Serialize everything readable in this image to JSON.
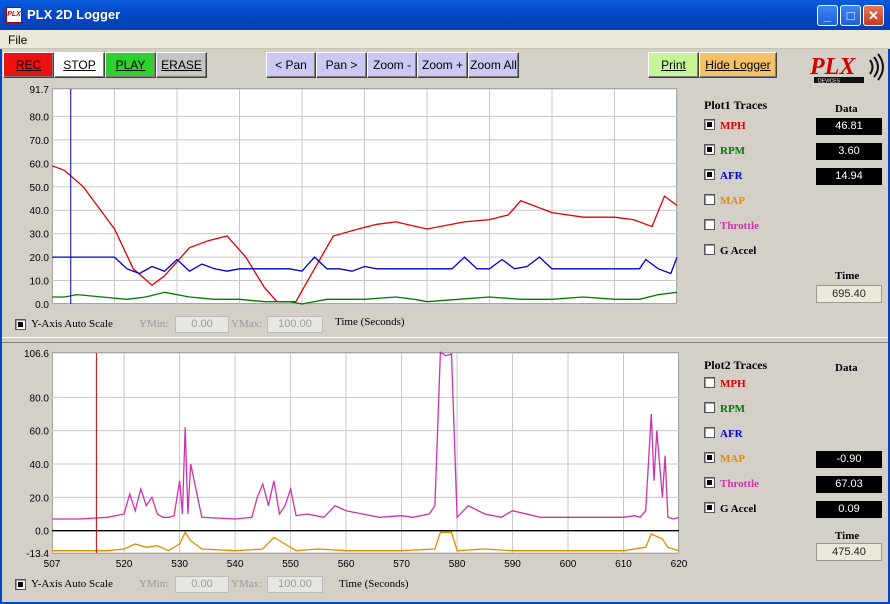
{
  "window": {
    "title": "PLX 2D Logger",
    "icon_text": "PLX",
    "minimize": "_",
    "maximize": "□",
    "close": "✕"
  },
  "menu": {
    "file": "File"
  },
  "toolbar": [
    {
      "name": "rec-button",
      "label": "REC",
      "bg": "#ee1111",
      "x": 3,
      "w": 51
    },
    {
      "name": "stop-button",
      "label": "STOP",
      "bg": "#ffffff",
      "x": 54,
      "w": 51
    },
    {
      "name": "play-button",
      "label": "PLAY",
      "bg": "#2ed12e",
      "x": 105,
      "w": 51
    },
    {
      "name": "erase-button",
      "label": "ERASE",
      "bg": "#c4c4c4",
      "x": 156,
      "w": 51
    },
    {
      "name": "pan-left-button",
      "label": "< Pan",
      "bg": "#c9c9f4",
      "x": 266,
      "w": 50,
      "nav": true
    },
    {
      "name": "pan-right-button",
      "label": "Pan >",
      "bg": "#c9c9f4",
      "x": 316,
      "w": 51,
      "nav": true
    },
    {
      "name": "zoom-out-button",
      "label": "Zoom -",
      "bg": "#c9c9f4",
      "x": 367,
      "w": 50,
      "nav": true
    },
    {
      "name": "zoom-in-button",
      "label": "Zoom +",
      "bg": "#c9c9f4",
      "x": 417,
      "w": 51,
      "nav": true
    },
    {
      "name": "zoom-all-button",
      "label": "Zoom All",
      "bg": "#c9c9f4",
      "x": 468,
      "w": 51,
      "nav": true
    },
    {
      "name": "print-button",
      "label": "Print",
      "bg": "#c8f59a",
      "x": 648,
      "w": 51
    },
    {
      "name": "hide-logger-button",
      "label": "Hide Logger",
      "bg": "#f5c066",
      "x": 699,
      "w": 78
    }
  ],
  "logo": {
    "text": "PLX",
    "subtext": "DEVICES"
  },
  "plot1": {
    "ymin_label": "YMin:",
    "ymin_value": "0.00",
    "ymax_label": "YMax:",
    "ymax_value": "100.00",
    "autoscale_label": "Y-Axis Auto Scale",
    "xlabel": "Time (Seconds)",
    "traces_title": "Plot1 Traces",
    "data_title": "Data",
    "time_title": "Time",
    "time_value": "695.40",
    "traces": [
      {
        "name": "MPH",
        "color": "#e00000",
        "checked": true,
        "value": "46.81"
      },
      {
        "name": "RPM",
        "color": "#007a00",
        "checked": true,
        "value": "3.60"
      },
      {
        "name": "AFR",
        "color": "#0000cc",
        "checked": true,
        "value": "14.94"
      },
      {
        "name": "MAP",
        "color": "#e88a00",
        "checked": false,
        "value": ""
      },
      {
        "name": "Throttle",
        "color": "#cc33aa",
        "checked": false,
        "value": ""
      },
      {
        "name": "G Accel",
        "color": "#000000",
        "checked": false,
        "value": ""
      }
    ]
  },
  "plot2": {
    "ymin_label": "YMin:",
    "ymin_value": "0.00",
    "ymax_label": "YMax:",
    "ymax_value": "100.00",
    "autoscale_label": "Y-Axis Auto Scale",
    "xlabel": "Time (Seconds)",
    "traces_title": "Plot2 Traces",
    "data_title": "Data",
    "time_title": "Time",
    "time_value": "475.40",
    "traces": [
      {
        "name": "MPH",
        "color": "#e00000",
        "checked": false,
        "value": ""
      },
      {
        "name": "RPM",
        "color": "#007a00",
        "checked": false,
        "value": ""
      },
      {
        "name": "AFR",
        "color": "#0000cc",
        "checked": false,
        "value": ""
      },
      {
        "name": "MAP",
        "color": "#e88a00",
        "checked": true,
        "value": "-0.90"
      },
      {
        "name": "Throttle",
        "color": "#cc33aa",
        "checked": true,
        "value": "67.03"
      },
      {
        "name": "G Accel",
        "color": "#000000",
        "checked": true,
        "value": "0.09"
      }
    ]
  },
  "chart_data": [
    {
      "type": "line",
      "ylim": [
        0,
        91.7
      ],
      "yticks": [
        "91.7",
        "80.0",
        "70.0",
        "60.0",
        "50.0",
        "40.0",
        "30.0",
        "20.0",
        "10.0",
        "0.0"
      ],
      "ytick_values": [
        91.7,
        80,
        70,
        60,
        50,
        40,
        30,
        20,
        10,
        0
      ],
      "xlim": [
        0,
        100
      ],
      "grid": true,
      "cursor_x": 3,
      "series": [
        {
          "name": "MPH",
          "color": "#e00000",
          "x": [
            0,
            2,
            5,
            10,
            13,
            16,
            18,
            20,
            22,
            25,
            28,
            31,
            34,
            36,
            39,
            42,
            45,
            49,
            52,
            55,
            60,
            66,
            70,
            73,
            75,
            80,
            85,
            90,
            93,
            96,
            98,
            100
          ],
          "y": [
            59,
            57,
            50,
            32,
            15,
            8,
            12,
            18,
            24,
            27,
            29,
            20,
            7,
            1,
            1,
            15,
            29,
            32,
            34,
            35,
            32,
            35,
            36,
            38,
            44,
            39,
            37,
            37,
            36,
            33,
            46,
            42
          ]
        },
        {
          "name": "RPM",
          "color": "#007a00",
          "x": [
            0,
            2,
            4,
            8,
            12,
            15,
            18,
            22,
            26,
            30,
            34,
            38,
            40,
            44,
            50,
            55,
            58,
            60,
            65,
            70,
            75,
            80,
            85,
            90,
            94,
            97,
            100
          ],
          "y": [
            3,
            3,
            4,
            3,
            2,
            3,
            5,
            3,
            2,
            2,
            1,
            1,
            0,
            2,
            2,
            3,
            2,
            1,
            2,
            3,
            2,
            2,
            3,
            2,
            2,
            4,
            5
          ]
        },
        {
          "name": "AFR",
          "color": "#0000cc",
          "x": [
            0,
            10,
            12,
            14,
            16,
            18,
            20,
            22,
            24,
            26,
            28,
            30,
            32,
            34,
            36,
            38,
            40,
            42,
            44,
            46,
            48,
            50,
            52,
            54,
            56,
            58,
            60,
            62,
            64,
            66,
            68,
            70,
            72,
            74,
            76,
            78,
            80,
            82,
            85,
            88,
            90,
            92,
            94,
            95,
            97,
            99,
            100
          ],
          "y": [
            20,
            20,
            15,
            13,
            16,
            14,
            19,
            14,
            17,
            15,
            14,
            15,
            15,
            15,
            15,
            15,
            14,
            20,
            15,
            15,
            14,
            16,
            15,
            15,
            15,
            15,
            15,
            15,
            15,
            20,
            15,
            15,
            19,
            15,
            16,
            20,
            15,
            15,
            15,
            15,
            15,
            15,
            15,
            19,
            15,
            13,
            20
          ]
        }
      ]
    },
    {
      "type": "line",
      "ylim": [
        -13.4,
        106.6
      ],
      "yticks": [
        "106.6",
        "80.0",
        "60.0",
        "40.0",
        "20.0",
        "0.0",
        "-13.4"
      ],
      "ytick_values": [
        106.6,
        80,
        60,
        40,
        20,
        0,
        -13.4
      ],
      "xlim": [
        507,
        620
      ],
      "xticks": [
        "507",
        "520",
        "530",
        "540",
        "550",
        "560",
        "570",
        "580",
        "590",
        "600",
        "610",
        "620"
      ],
      "xtick_values": [
        507,
        520,
        530,
        540,
        550,
        560,
        570,
        580,
        590,
        600,
        610,
        620
      ],
      "grid": true,
      "cursor_x": 515,
      "series": [
        {
          "name": "Throttle",
          "color": "#cc33aa",
          "x": [
            507,
            512,
            517,
            520,
            521,
            522,
            523,
            524,
            525,
            526,
            527,
            528,
            529,
            530,
            530.5,
            531,
            531.5,
            532,
            534,
            540,
            543,
            544,
            545,
            546,
            547,
            548,
            549,
            550,
            551,
            553,
            556,
            558,
            560,
            563,
            566,
            570,
            572,
            575,
            576,
            577,
            578,
            579,
            580,
            582,
            585,
            588,
            590,
            595,
            600,
            605,
            610,
            612,
            613,
            614,
            615,
            615.5,
            616,
            617,
            617.5,
            618,
            619,
            620
          ],
          "y": [
            7,
            7,
            8,
            10,
            22,
            12,
            25,
            15,
            20,
            10,
            8,
            8,
            9,
            30,
            10,
            62,
            10,
            40,
            8,
            7,
            8,
            20,
            28,
            15,
            30,
            10,
            15,
            25,
            9,
            10,
            8,
            15,
            12,
            10,
            8,
            9,
            8,
            10,
            15,
            107,
            105,
            106,
            8,
            15,
            10,
            8,
            12,
            8,
            8,
            8,
            8,
            9,
            8,
            12,
            70,
            30,
            60,
            20,
            45,
            8,
            7,
            8
          ]
        },
        {
          "name": "MAP",
          "color": "#e88a00",
          "x": [
            507,
            517,
            520,
            522,
            524,
            526,
            528,
            530,
            531,
            532,
            534,
            540,
            545,
            547,
            549,
            551,
            555,
            560,
            570,
            576,
            577,
            579,
            580,
            585,
            590,
            600,
            610,
            614,
            615,
            617,
            618,
            620
          ],
          "y": [
            -12,
            -12,
            -11,
            -8,
            -10,
            -9,
            -12,
            -8,
            -1,
            -6,
            -11,
            -12,
            -11,
            -4,
            -8,
            -12,
            -11,
            -12,
            -12,
            -11,
            -1,
            -1,
            -12,
            -11,
            -12,
            -12,
            -12,
            -10,
            -2,
            -5,
            -10,
            -12
          ]
        },
        {
          "name": "G Accel",
          "color": "#000000",
          "x": [
            507,
            520,
            540,
            560,
            580,
            600,
            620
          ],
          "y": [
            0,
            0,
            0,
            0,
            0,
            0,
            0
          ]
        }
      ]
    }
  ]
}
